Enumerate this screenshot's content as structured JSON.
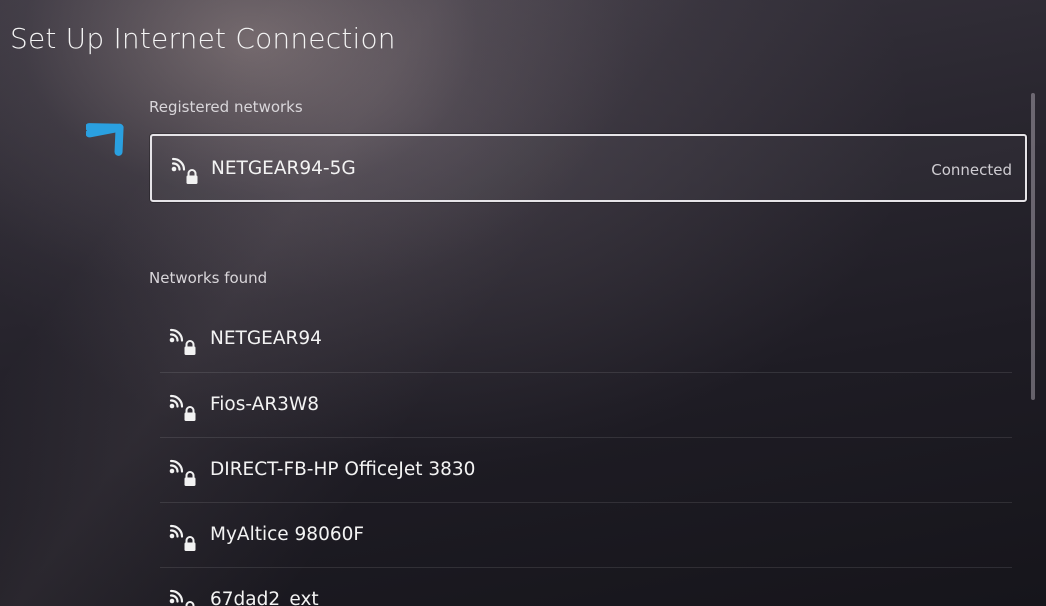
{
  "page": {
    "title": "Set Up Internet Connection"
  },
  "registered": {
    "section_label": "Registered networks",
    "network": {
      "name": "NETGEAR94-5G",
      "status": "Connected",
      "icon": "wifi-locked-icon"
    }
  },
  "found": {
    "section_label": "Networks found",
    "networks": [
      {
        "name": "NETGEAR94",
        "icon": "wifi-locked-icon"
      },
      {
        "name": "Fios-AR3W8",
        "icon": "wifi-locked-icon"
      },
      {
        "name": "DIRECT-FB-HP OfficeJet 3830",
        "icon": "wifi-locked-icon"
      },
      {
        "name": "MyAltice 98060F",
        "icon": "wifi-locked-icon"
      },
      {
        "name": "67dad2_ext",
        "icon": "wifi-locked-icon"
      }
    ]
  },
  "annotation": {
    "arrow_color": "#2aa0e0"
  },
  "colors": {
    "text_primary": "#f3f3f3",
    "focus_border": "#e6e4e8"
  }
}
